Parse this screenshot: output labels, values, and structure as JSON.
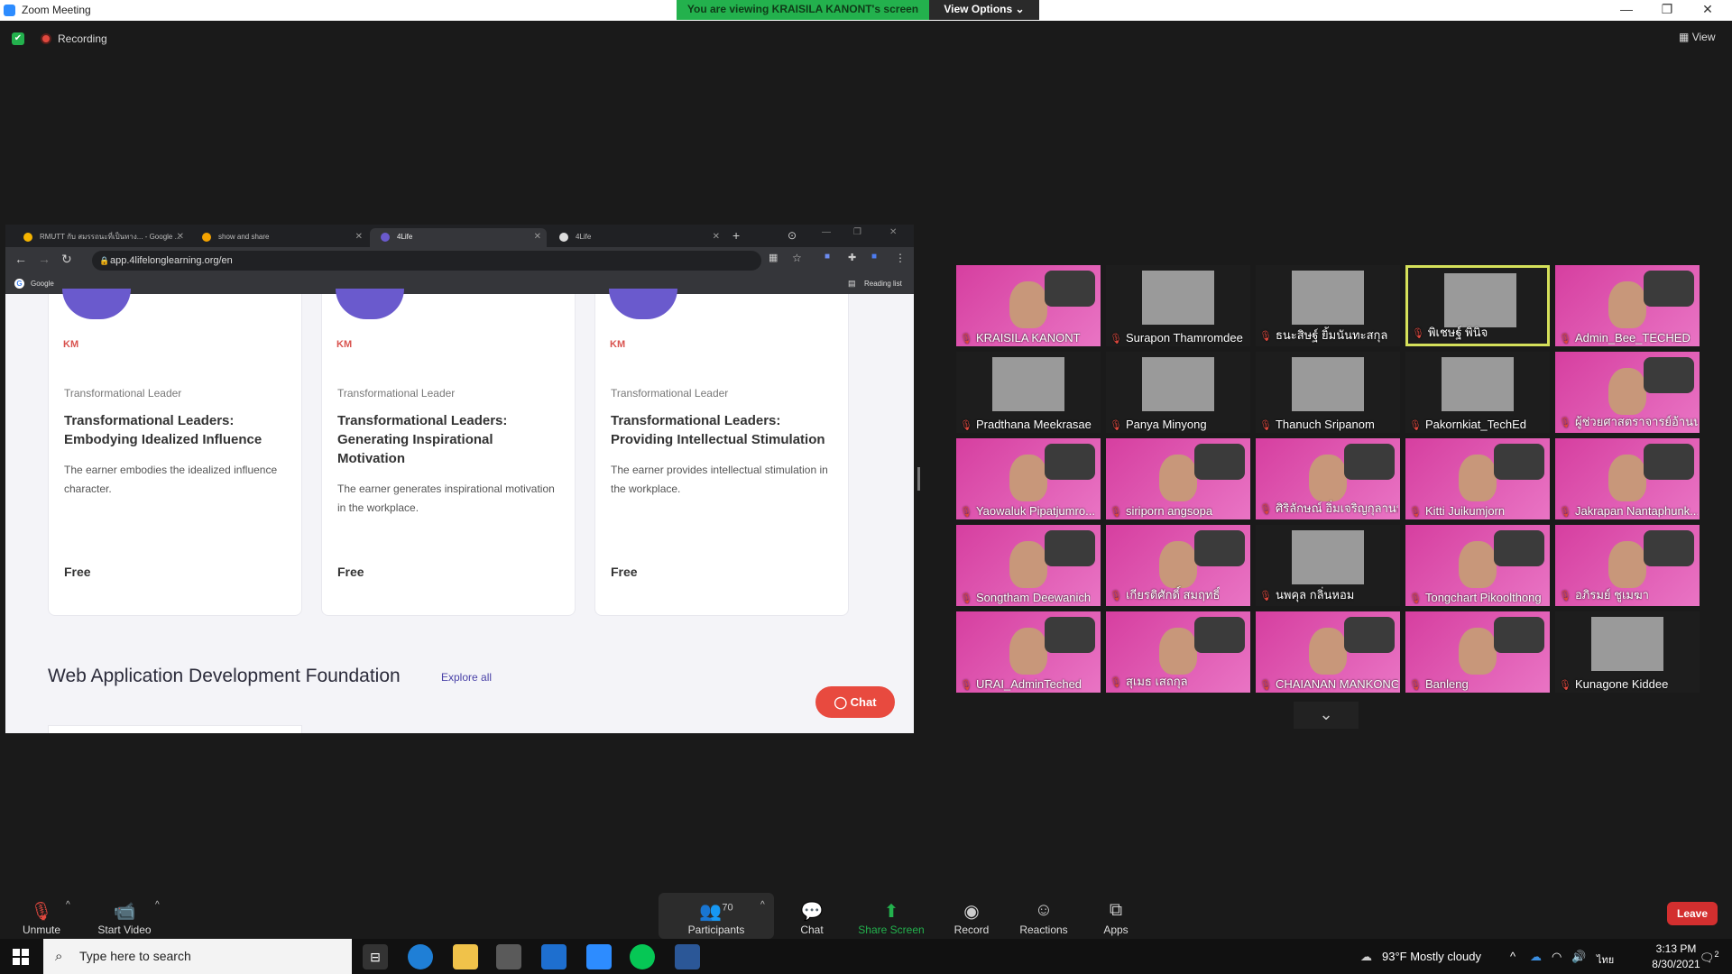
{
  "window": {
    "title": "Zoom Meeting",
    "viewing_banner": "You are viewing KRAISILA KANONT's screen",
    "view_options": "View Options"
  },
  "meeting": {
    "recording": "Recording",
    "view_label": "View"
  },
  "browser": {
    "tabs": [
      "RMUTT กับ สมรรถนะที่เป็นทาง... - Google ...",
      "show and share",
      "4Life",
      "4Life"
    ],
    "url": "app.4lifelonglearning.org/en",
    "bookmark": "Google",
    "reading_list": "Reading list"
  },
  "page": {
    "cards": [
      {
        "category": "Transformational Leader",
        "title": "Transformational Leaders: Embodying Idealized Influence",
        "desc": "The earner embodies the idealized influence character.",
        "price": "Free"
      },
      {
        "category": "Transformational Leader",
        "title": "Transformational Leaders: Generating Inspirational Motivation",
        "desc": "The earner generates inspirational motivation in the workplace.",
        "price": "Free"
      },
      {
        "category": "Transformational Leader",
        "title": "Transformational Leaders: Providing Intellectual Stimulation",
        "desc": "The earner provides intellectual stimulation in the workplace.",
        "price": "Free"
      }
    ],
    "section_title": "Web Application Development Foundation",
    "explore_all": "Explore all",
    "chat": "Chat"
  },
  "participants": [
    {
      "name": "KRAISILA KANONT",
      "style": "pink"
    },
    {
      "name": "Surapon Thamromdee",
      "style": "dark"
    },
    {
      "name": "ธนะสิษฐ์ ยิ้มนันทะสกุล",
      "style": "dark"
    },
    {
      "name": "พิเชษฐ์ พินิจ",
      "style": "green"
    },
    {
      "name": "Admin_Bee_TECHED",
      "style": "pink"
    },
    {
      "name": "Pradthana Meekrasae",
      "style": "dark"
    },
    {
      "name": "Panya Minyong",
      "style": "dark"
    },
    {
      "name": "Thanuch Sripanom",
      "style": "dark"
    },
    {
      "name": "Pakornkiat_TechEd",
      "style": "dark"
    },
    {
      "name": "ผู้ช่วยศาสตราจารย์อ้านน...",
      "style": "pink"
    },
    {
      "name": "Yaowaluk Pipatjumro...",
      "style": "pink"
    },
    {
      "name": "siriporn angsopa",
      "style": "pink"
    },
    {
      "name": "ศิริลักษณ์ อิ่มเจริญกุลานนท์",
      "style": "pink"
    },
    {
      "name": "Kitti Juikumjorn",
      "style": "pink"
    },
    {
      "name": "Jakrapan Nantaphunk...",
      "style": "pink"
    },
    {
      "name": "Songtham Deewanich",
      "style": "pink"
    },
    {
      "name": "เกียรติศักดิ์ สมฤทธิ์",
      "style": "pink"
    },
    {
      "name": "นพคุล กลิ่นหอม",
      "style": "dark"
    },
    {
      "name": "Tongchart Pikoolthong",
      "style": "pink"
    },
    {
      "name": "อภิรมย์ ชูเมฆา",
      "style": "pink"
    },
    {
      "name": "URAI_AdminTeched",
      "style": "pink"
    },
    {
      "name": "สุเมธ เสถกุล",
      "style": "pink"
    },
    {
      "name": "CHAIANAN MANKONG",
      "style": "pink"
    },
    {
      "name": "Banleng",
      "style": "pink"
    },
    {
      "name": "Kunagone Kiddee",
      "style": "dark"
    }
  ],
  "toolbar": {
    "unmute": "Unmute",
    "start_video": "Start Video",
    "participants": "Participants",
    "participants_count": "70",
    "chat": "Chat",
    "share_screen": "Share Screen",
    "record": "Record",
    "reactions": "Reactions",
    "apps": "Apps",
    "leave": "Leave"
  },
  "taskbar": {
    "search_placeholder": "Type here to search",
    "weather": "93°F  Mostly cloudy",
    "lang": "ไทย",
    "time": "3:13 PM",
    "date": "8/30/2021",
    "notif": "2"
  },
  "colors": {
    "zoom_blue": "#2d8cff",
    "banner_green": "#23b14d",
    "leave_red": "#d32f2f",
    "tile_pink": "#d63fa0",
    "chat_red": "#e84a3f"
  }
}
